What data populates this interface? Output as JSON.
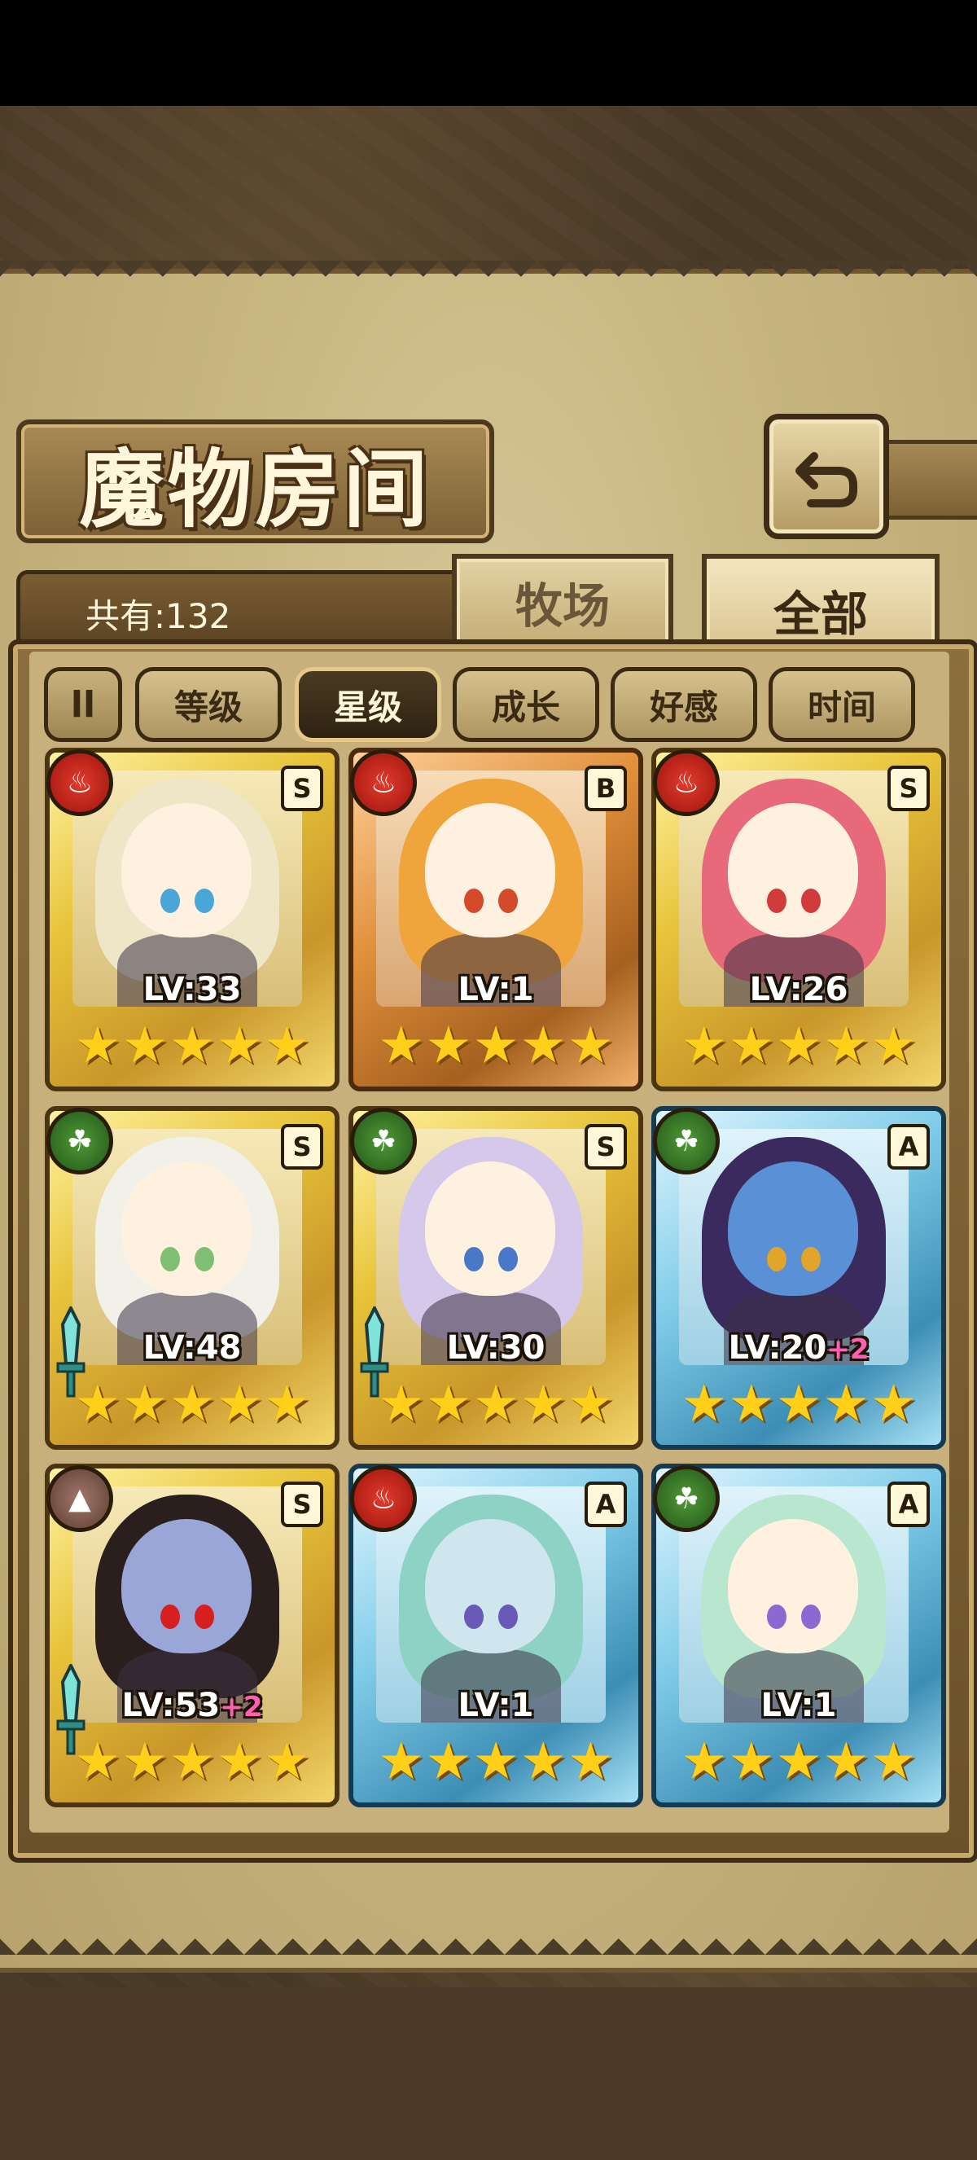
{
  "header": {
    "title": "魔物房间",
    "back_icon": "return-arrow-icon"
  },
  "summary": {
    "count_label": "共有:132"
  },
  "tabs": [
    {
      "label": "牧场",
      "active": false
    },
    {
      "label": "全部",
      "active": true
    }
  ],
  "sort_buttons": [
    {
      "label": "等级",
      "active": false
    },
    {
      "label": "星级",
      "active": true
    },
    {
      "label": "成长",
      "active": false
    },
    {
      "label": "好感",
      "active": false
    },
    {
      "label": "时间",
      "active": false
    }
  ],
  "pause_icon": "ll",
  "monsters": [
    {
      "element": "fire",
      "rank": "S",
      "level": "LV:33",
      "bonus": "",
      "stars": 5,
      "frame": "gold",
      "weapon": false,
      "hair": "#efe6c8",
      "eyes": "#4aa6d6",
      "skin": "#fff1e0"
    },
    {
      "element": "fire",
      "rank": "B",
      "level": "LV:1",
      "bonus": "",
      "stars": 5,
      "frame": "bronze",
      "weapon": false,
      "hair": "#f0a53c",
      "eyes": "#d44a2a",
      "skin": "#fff1e0"
    },
    {
      "element": "fire",
      "rank": "S",
      "level": "LV:26",
      "bonus": "",
      "stars": 5,
      "frame": "gold",
      "weapon": false,
      "hair": "#e86a7a",
      "eyes": "#d23b3b",
      "skin": "#fff1e0"
    },
    {
      "element": "wood",
      "rank": "S",
      "level": "LV:48",
      "bonus": "",
      "stars": 5,
      "frame": "gold",
      "weapon": true,
      "hair": "#f1f1ea",
      "eyes": "#7fbf74",
      "skin": "#fff1e0"
    },
    {
      "element": "wood",
      "rank": "S",
      "level": "LV:30",
      "bonus": "",
      "stars": 5,
      "frame": "gold",
      "weapon": true,
      "hair": "#d6c8ea",
      "eyes": "#4a78c9",
      "skin": "#fff1e0"
    },
    {
      "element": "wood",
      "rank": "A",
      "level": "LV:20",
      "bonus": "+2",
      "stars": 5,
      "frame": "blue",
      "weapon": false,
      "hair": "#3b2a5e",
      "eyes": "#e0a52a",
      "skin": "#5a90d6"
    },
    {
      "element": "earth",
      "rank": "S",
      "level": "LV:53",
      "bonus": "+2",
      "stars": 5,
      "frame": "gold",
      "weapon": true,
      "hair": "#2a1f1c",
      "eyes": "#d62020",
      "skin": "#9aa6d8"
    },
    {
      "element": "fire",
      "rank": "A",
      "level": "LV:1",
      "bonus": "",
      "stars": 5,
      "frame": "blue",
      "weapon": false,
      "hair": "#8ed2c6",
      "eyes": "#6a5ab8",
      "skin": "#cfe6ef"
    },
    {
      "element": "wood",
      "rank": "A",
      "level": "LV:1",
      "bonus": "",
      "stars": 5,
      "frame": "blue",
      "weapon": false,
      "hair": "#b9e6cf",
      "eyes": "#8a6ad0",
      "skin": "#fff1e0"
    }
  ]
}
